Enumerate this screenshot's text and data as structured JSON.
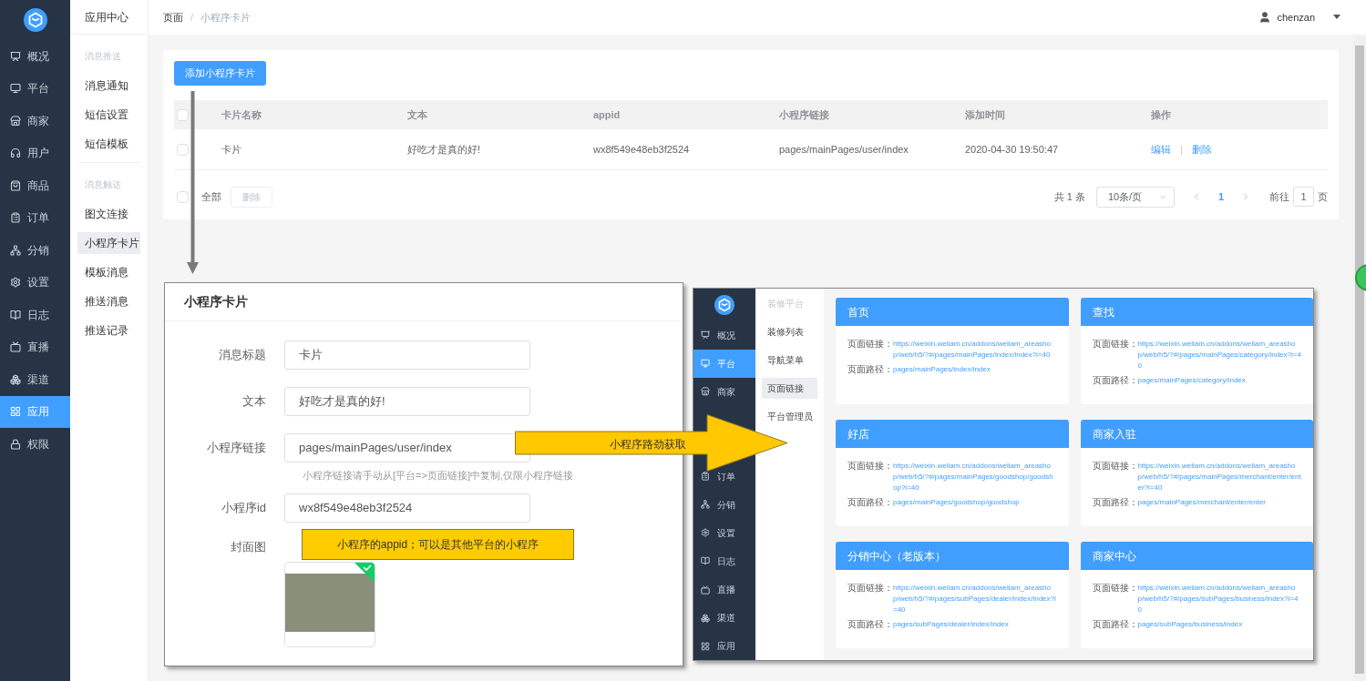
{
  "sidebar": {
    "items": [
      {
        "label": "概况",
        "selected": false
      },
      {
        "label": "平台",
        "selected": false
      },
      {
        "label": "商家",
        "selected": false
      },
      {
        "label": "用户",
        "selected": false
      },
      {
        "label": "商品",
        "selected": false
      },
      {
        "label": "订单",
        "selected": false
      },
      {
        "label": "分销",
        "selected": false
      },
      {
        "label": "设置",
        "selected": false
      },
      {
        "label": "日志",
        "selected": false
      },
      {
        "label": "直播",
        "selected": false
      },
      {
        "label": "渠道",
        "selected": false
      },
      {
        "label": "应用",
        "selected": true
      },
      {
        "label": "权限",
        "selected": false
      }
    ]
  },
  "sub_sidebar": {
    "title": "应用中心",
    "groups": [
      {
        "heading": "消息推送",
        "items": [
          {
            "label": "消息通知",
            "selected": false
          },
          {
            "label": "短信设置",
            "selected": false
          },
          {
            "label": "短信模板",
            "selected": false
          }
        ]
      },
      {
        "heading": "消息触达",
        "items": [
          {
            "label": "图文连接",
            "selected": false
          },
          {
            "label": "小程序卡片",
            "selected": true
          },
          {
            "label": "模板消息",
            "selected": false
          },
          {
            "label": "推送消息",
            "selected": false
          },
          {
            "label": "推送记录",
            "selected": false
          }
        ]
      }
    ]
  },
  "header": {
    "breadcrumb": [
      "页面",
      "小程序卡片"
    ],
    "breadcrumb_separator": "/",
    "user": "chenzan"
  },
  "add_button": "添加小程序卡片",
  "table": {
    "header_checked": false,
    "columns": [
      "卡片名称",
      "文本",
      "appid",
      "小程序链接",
      "添加时间",
      "操作"
    ],
    "rows": [
      {
        "checked": false,
        "cells": [
          "卡片",
          "好吃才是真的好!",
          "wx8f549e48eb3f2524",
          "pages/mainPages/user/index",
          "2020-04-30 19:50:47"
        ],
        "actions": [
          "编辑",
          "删除"
        ],
        "action_separator": "|"
      }
    ]
  },
  "table_footer": {
    "select_all": {
      "label": "全部",
      "checked": false
    },
    "delete_button": {
      "label": "删除",
      "disabled": true
    }
  },
  "pagination": {
    "total": "共 1 条",
    "page_size": "10条/页",
    "pages": [
      {
        "label": "1",
        "selected": true
      }
    ],
    "goto_label": "前往",
    "goto_value": "1",
    "goto_suffix": "页"
  },
  "modal": {
    "title": "小程序卡片",
    "fields": [
      {
        "kind": "input",
        "label": "消息标题",
        "value": "卡片"
      },
      {
        "kind": "input",
        "label": "文本",
        "value": "好吃才是真的好!"
      },
      {
        "kind": "input",
        "label": "小程序链接",
        "value": "pages/mainPages/user/index",
        "hint": "小程序链接请手动从[平台=>页面链接]中复制,仅限小程序链接"
      },
      {
        "kind": "input",
        "label": "小程序id",
        "value": "wx8f549e48eb3f2524"
      },
      {
        "kind": "image",
        "label": "封面图",
        "checked": true
      }
    ]
  },
  "callouts": {
    "route_arrow": "小程序路劲获取",
    "appid_note": "小程序的appid；可以是其他平台的小程序"
  },
  "inner_screenshot": {
    "sidebar": [
      {
        "label": "概况",
        "selected": false
      },
      {
        "label": "平台",
        "selected": true
      },
      {
        "label": "商家",
        "selected": false
      },
      {
        "label": "订单",
        "selected": false
      },
      {
        "label": "分销",
        "selected": false
      },
      {
        "label": "设置",
        "selected": false
      },
      {
        "label": "日志",
        "selected": false
      },
      {
        "label": "直播",
        "selected": false
      },
      {
        "label": "渠道",
        "selected": false
      },
      {
        "label": "应用",
        "selected": false
      }
    ],
    "menu": {
      "heading": "装修平台",
      "items": [
        {
          "label": "装修列表",
          "selected": false
        },
        {
          "label": "导航菜单",
          "selected": false
        },
        {
          "label": "页面链接",
          "selected": true
        },
        {
          "label": "平台管理员",
          "selected": false
        }
      ]
    },
    "cards": [
      {
        "title": "首页",
        "link_label": "页面链接：",
        "link": "https://weixin.weliam.cn/addons/weliam_areashop/web/h5/?#/pages/mainPages/index/index?i=40",
        "path_label": "页面路径：",
        "path": "pages/mainPages/index/index"
      },
      {
        "title": "查找",
        "link_label": "页面链接：",
        "link": "https://weixin.weliam.cn/addons/weliam_areashop/web/h5/?#/pages/mainPages/category/index?i=40",
        "path_label": "页面路径：",
        "path": "pages/mainPages/category/index"
      },
      {
        "title": "好店",
        "link_label": "页面链接：",
        "link": "https://weixin.weliam.cn/addons/weliam_areashop/web/h5/?#/pages/mainPages/goodshop/goodshop?i=40",
        "path_label": "页面路径：",
        "path": "pages/mainPages/goodshop/goodshop"
      },
      {
        "title": "商家入驻",
        "link_label": "页面链接：",
        "link": "https://weixin.weliam.cn/addons/weliam_areashop/web/h5/?#/pages/mainPages/merchant/enter/enter?i=40",
        "path_label": "页面路径：",
        "path": "pages/mainPages/merchant/enter/enter"
      },
      {
        "title": "分销中心（老版本）",
        "link_label": "页面链接：",
        "link": "https://weixin.weliam.cn/addons/weliam_areashop/web/h5/?#/pages/subPages/dealer/index/index?i=40",
        "path_label": "页面路径：",
        "path": "pages/subPages/dealer/index/index"
      },
      {
        "title": "商家中心",
        "link_label": "页面链接：",
        "link": "https://weixin.weliam.cn/addons/weliam_areashop/web/h5/?#/pages/subPages/business/index?i=40",
        "path_label": "页面路径：",
        "path": "pages/subPages/business/index"
      }
    ]
  }
}
